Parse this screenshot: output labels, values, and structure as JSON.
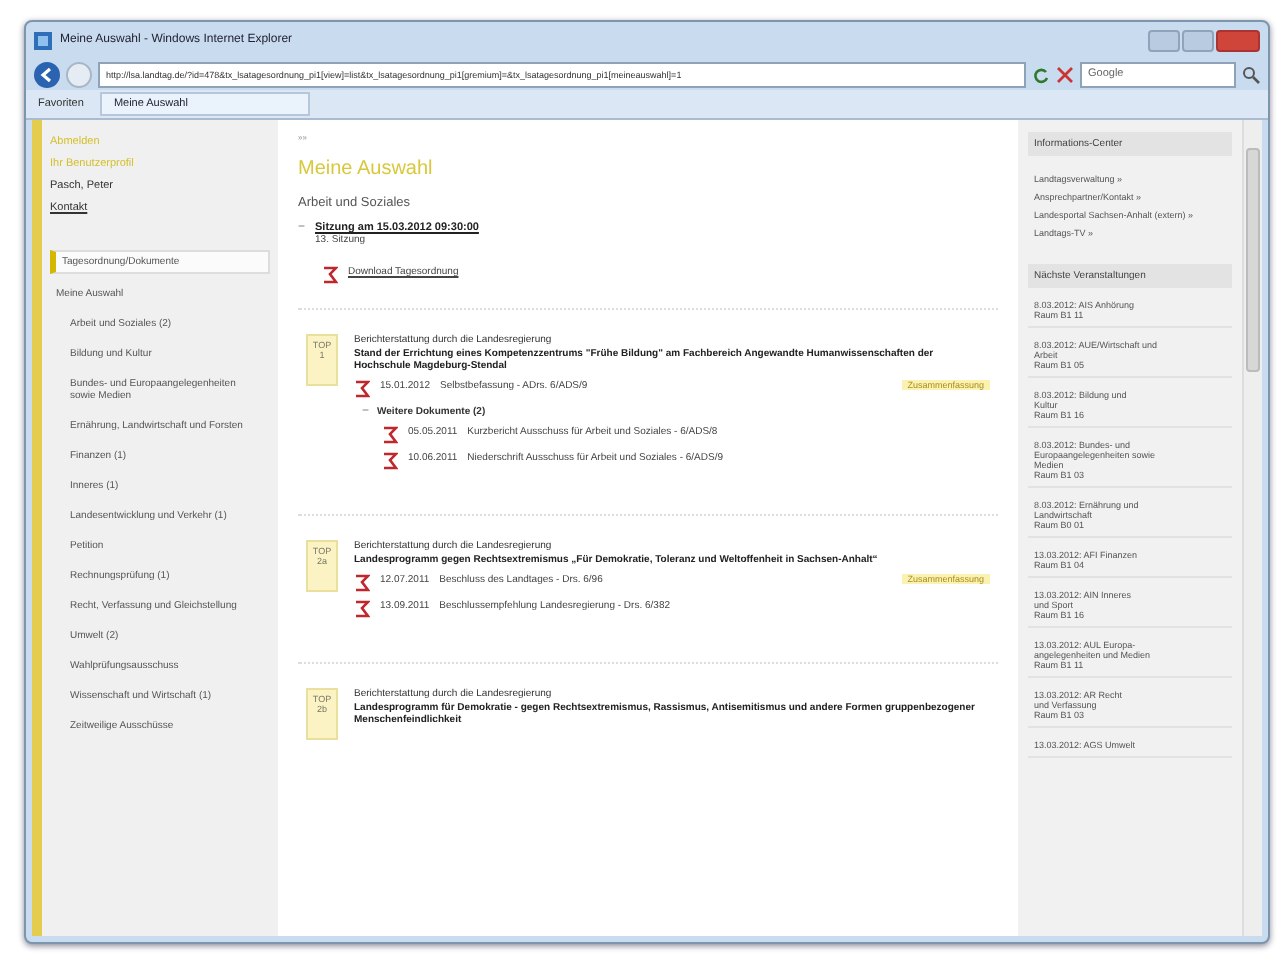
{
  "window": {
    "title": "Meine Auswahl - Windows Internet Explorer"
  },
  "browser": {
    "url": "http://lsa.landtag.de/?id=478&tx_lsatagesordnung_pi1[view]=list&tx_lsatagesordnung_pi1[gremium]=&tx_lsatagesordnung_pi1[meineauswahl]=1",
    "search_placeholder": "Google",
    "favorites": "Favoriten",
    "tab": "Meine Auswahl"
  },
  "sidebar": {
    "account": [
      {
        "text": "Abmelden",
        "kind": "highlight"
      },
      {
        "text": "Ihr Benutzerprofil",
        "kind": "highlight"
      },
      {
        "text": "Pasch, Peter",
        "kind": "plain"
      },
      {
        "text": "Kontakt",
        "kind": "link"
      }
    ],
    "nav": [
      {
        "label": "Tagesordnung/Dokumente",
        "selected": true
      },
      {
        "label": "Meine Auswahl",
        "selected": false,
        "children": [
          {
            "label": "Arbeit und Soziales (2)",
            "selected": false
          },
          {
            "label": "Bildung und Kultur",
            "selected": false
          },
          {
            "label": "Bundes- und Europaangelegenheiten sowie Medien",
            "selected": false
          },
          {
            "label": "Ernährung, Landwirtschaft und Forsten",
            "selected": false
          },
          {
            "label": "Finanzen (1)",
            "selected": false
          },
          {
            "label": "Inneres (1)",
            "selected": false
          },
          {
            "label": "Landesentwicklung und Verkehr (1)",
            "selected": false
          },
          {
            "label": "Petition",
            "selected": false
          },
          {
            "label": "Rechnungsprüfung (1)",
            "selected": false
          },
          {
            "label": "Recht, Verfassung und Gleichstellung",
            "selected": false
          },
          {
            "label": "Umwelt (2)",
            "selected": false
          },
          {
            "label": "Wahlprüfungsausschuss",
            "selected": false
          },
          {
            "label": "Wissenschaft und Wirtschaft (1)",
            "selected": false
          },
          {
            "label": "Zeitweilige Ausschüsse",
            "selected": false
          }
        ]
      }
    ]
  },
  "main": {
    "breadcrumb": "»»",
    "title": "Meine Auswahl",
    "subtitle": "Arbeit und Soziales",
    "session": {
      "toggle": "−",
      "title": "Sitzung am 15.03.2012 09:30:00",
      "number": "13. Sitzung",
      "download": "Download Tagesordnung"
    },
    "tops": [
      {
        "badge": "TOP",
        "number": "1",
        "intro": "Berichterstattung durch die Landesregierung",
        "title": "Stand der Errichtung eines Kompetenzzentrums \"Frühe Bildung\" am Fachbereich Angewandte Humanwissenschaften der Hochschule Magdeburg-Stendal",
        "documents": [
          {
            "date": "15.01.2012",
            "text": "Selbstbefassung - ADrs. 6/ADS/9",
            "note": "Zusammenfassung"
          }
        ],
        "more": {
          "toggle": "−",
          "label": "Weitere Dokumente (2)",
          "documents": [
            {
              "date": "05.05.2011",
              "text": "Kurzbericht Ausschuss für Arbeit und Soziales - 6/ADS/8"
            },
            {
              "date": "10.06.2011",
              "text": "Niederschrift Ausschuss für Arbeit und Soziales - 6/ADS/9"
            }
          ]
        }
      },
      {
        "badge": "TOP",
        "number": "2a",
        "intro": "Berichterstattung durch die Landesregierung",
        "title": "Landesprogramm gegen Rechtsextremismus „Für Demokratie, Toleranz und Weltoffenheit in Sachsen-Anhalt“",
        "documents": [
          {
            "date": "12.07.2011",
            "text": "Beschluss des Landtages - Drs. 6/96",
            "note": "Zusammenfassung"
          },
          {
            "date": "13.09.2011",
            "text": "Beschlussempfehlung Landesregierung - Drs. 6/382"
          }
        ]
      },
      {
        "badge": "TOP",
        "number": "2b",
        "intro": "Berichterstattung durch die Landesregierung",
        "title": "Landesprogramm für Demokratie - gegen Rechtsextremismus, Rassismus, Antisemitismus und andere Formen gruppenbezogener Menschenfeindlichkeit"
      }
    ]
  },
  "right": {
    "info": {
      "title": "Informations-Center",
      "links": [
        "Landtagsverwaltung  »",
        "Ansprechpartner/Kontakt  »",
        "Landesportal Sachsen-Anhalt (extern)  »",
        "Landtags-TV  »"
      ]
    },
    "events": {
      "title": "Nächste Veranstaltungen",
      "items": [
        {
          "lines": [
            "8.03.2012: AIS Anhörung",
            "Raum B1 11"
          ]
        },
        {
          "lines": [
            "8.03.2012: AUE/Wirtschaft und",
            "Arbeit",
            "Raum B1 05"
          ]
        },
        {
          "lines": [
            "8.03.2012: Bildung und",
            "Kultur",
            "Raum B1 16"
          ]
        },
        {
          "lines": [
            "8.03.2012: Bundes- und",
            "Europaangelegenheiten sowie",
            "Medien",
            "Raum B1 03"
          ]
        },
        {
          "lines": [
            "8.03.2012: Ernährung und",
            "Landwirtschaft",
            "Raum B0 01"
          ]
        },
        {
          "lines": [
            "13.03.2012: AFI Finanzen",
            "Raum B1 04"
          ]
        },
        {
          "lines": [
            "13.03.2012: AIN Inneres",
            "und Sport",
            "Raum B1 16"
          ]
        },
        {
          "lines": [
            "13.03.2012: AUL Europa-",
            "angelegenheiten und Medien",
            "Raum B1 11"
          ]
        },
        {
          "lines": [
            "13.03.2012: AR Recht",
            "und Verfassung",
            "Raum B1 03"
          ]
        },
        {
          "lines": [
            "13.03.2012: AGS Umwelt"
          ]
        }
      ]
    }
  }
}
